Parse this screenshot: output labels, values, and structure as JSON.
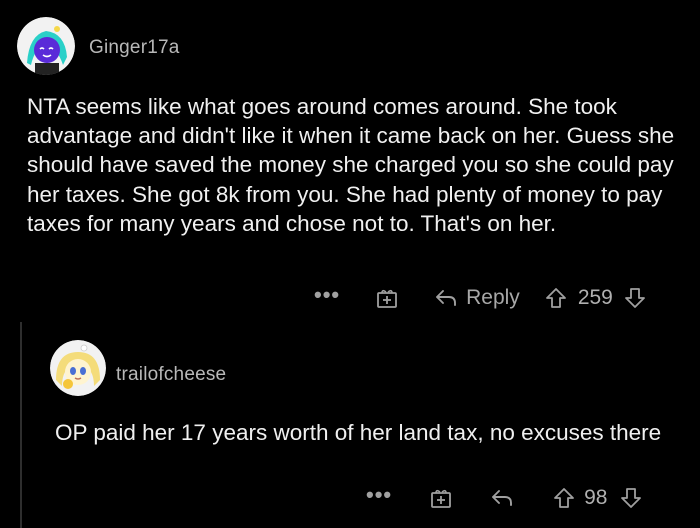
{
  "comments": [
    {
      "username": "Ginger17a",
      "text": "NTA seems like what goes around comes around. She took advantage and didn't like it when it came back on her. Guess she should have saved the money she charged you so she could pay her taxes. She got 8k from you.  She had plenty of money to pay taxes for many years and chose not to. That's on her.",
      "actions": {
        "more_label": "•••",
        "reply_label": "Reply",
        "score": "259"
      },
      "avatar_colors": {
        "face": "#5a2bd8",
        "hair": "#2ad0c8",
        "bg": "#f2f2f2"
      }
    },
    {
      "username": "trailofcheese",
      "text": "OP paid her 17 years worth of her land tax, no excuses there",
      "actions": {
        "more_label": "•••",
        "score": "98"
      },
      "avatar_colors": {
        "face": "#fff4d0",
        "hair": "#f4dc7a",
        "bg": "#f2f2f2"
      }
    }
  ],
  "theme": {
    "background": "#000000",
    "text": "#f0f0f0",
    "muted": "#a0a0a0"
  }
}
